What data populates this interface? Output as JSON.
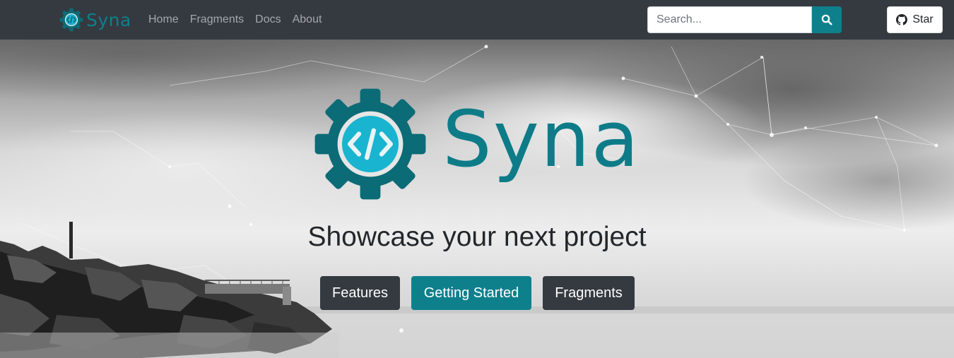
{
  "navbar": {
    "brand": "Syna",
    "links": [
      {
        "label": "Home"
      },
      {
        "label": "Fragments"
      },
      {
        "label": "Docs"
      },
      {
        "label": "About"
      }
    ],
    "search": {
      "placeholder": "Search...",
      "value": ""
    },
    "star_label": "Star"
  },
  "hero": {
    "title": "Syna",
    "tagline": "Showcase your next project",
    "buttons": {
      "features": "Features",
      "getting_started": "Getting Started",
      "fragments": "Fragments"
    }
  },
  "colors": {
    "navbar_bg": "#343a40",
    "brand_teal": "#0e808c",
    "gear_dark": "#0b6b76",
    "gear_light": "#19b4cf",
    "button_dark": "#343a40"
  },
  "icons": [
    "syna-logo-icon",
    "search-icon",
    "github-icon"
  ]
}
